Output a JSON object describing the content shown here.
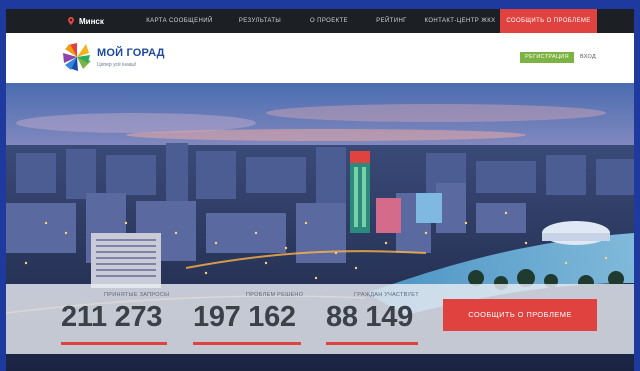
{
  "topnav": {
    "city": "Минск",
    "items": [
      {
        "label": "Карта сообщений"
      },
      {
        "label": "Результаты"
      },
      {
        "label": "О проекте"
      },
      {
        "label": "Рейтинг"
      },
      {
        "label": "Контакт-центр ЖКХ"
      },
      {
        "label": "Сообщить о проблеме"
      }
    ]
  },
  "header": {
    "brand": "МОЙ ГОРАД",
    "slogan": "Цяпер усё інакш!",
    "register_label": "РЕГИСТРАЦИЯ",
    "login_label": "ВХОД"
  },
  "stats": [
    {
      "label": "ПРИНЯТЫЕ ЗАПРОСЫ",
      "value": "211 273"
    },
    {
      "label": "ПРОБЛЕМ РЕШЕНО",
      "value": "197 162"
    },
    {
      "label": "ГРАЖДАН УЧАСТВУЕТ",
      "value": "88 149"
    }
  ],
  "cta": {
    "report_label": "СООБЩИТЬ О ПРОБЛЕМЕ"
  },
  "colors": {
    "accent": "#e0433f",
    "brand": "#1c4aa0",
    "nav_bg": "#1c1f24",
    "register": "#7cb342"
  },
  "icons": {
    "city": "map-pin-icon",
    "logo": "pinwheel-logo"
  }
}
